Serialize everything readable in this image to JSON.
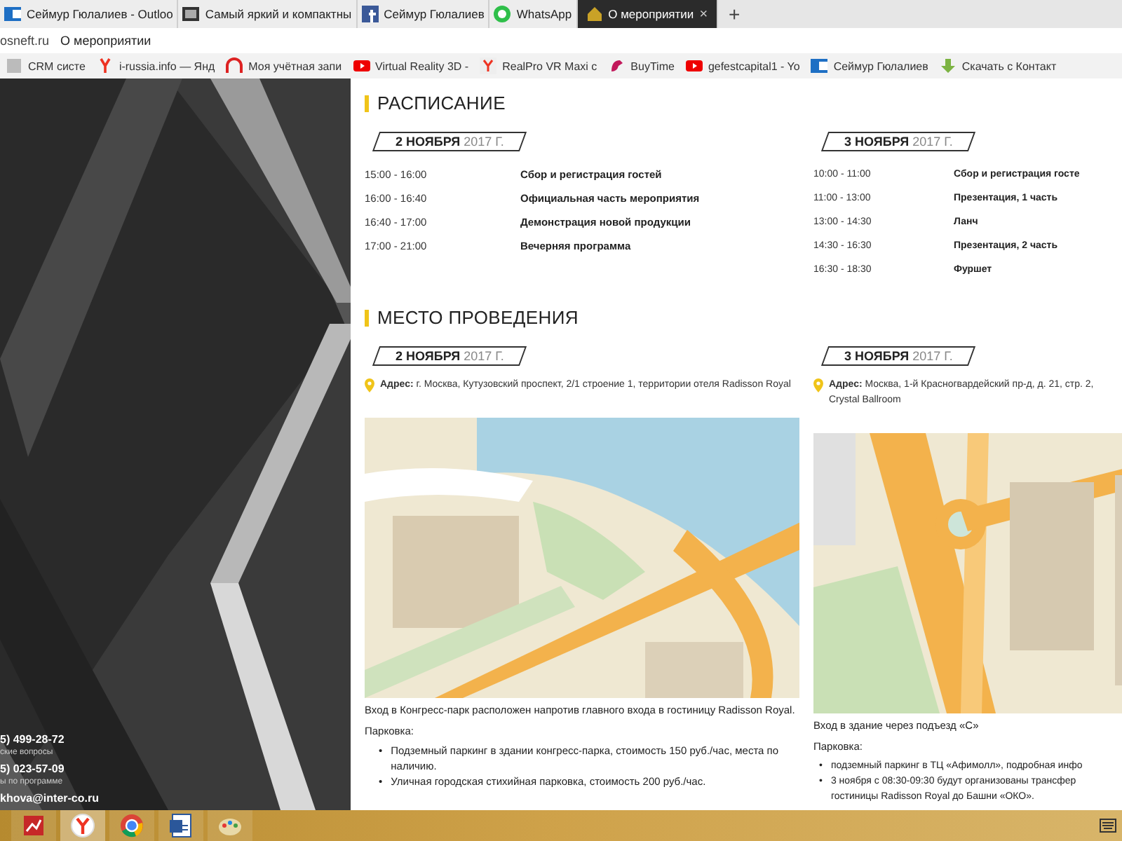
{
  "browser": {
    "tabs": [
      {
        "title": "Сеймур Гюлалиев - Outloo",
        "selected": false
      },
      {
        "title": "Самый яркий и компактны",
        "selected": false
      },
      {
        "title": "Сеймур Гюлалиев",
        "selected": false
      },
      {
        "title": "WhatsApp",
        "selected": false
      },
      {
        "title": "О мероприятии",
        "selected": true
      }
    ],
    "close": "×",
    "new_tab": "+",
    "address": {
      "host": "osneft.ru",
      "page_title": "О мероприятии"
    },
    "bookmarks": [
      "CRM систе",
      "i-russia.info — Янд",
      "Моя учётная запи",
      "Virtual Reality 3D -",
      "RealPro VR Maxi c",
      "BuyTime",
      "gefestcapital1 - Yo",
      "Сеймур Гюлалиев",
      "Скачать с Контакт"
    ]
  },
  "sidebar": {
    "contacts": [
      {
        "phone": "5) 499-28-72",
        "caption": "ские вопросы"
      },
      {
        "phone": "5) 023-57-09",
        "caption": "ы по программе"
      }
    ],
    "email": "khova@inter-co.ru"
  },
  "schedule": {
    "title": "РАСПИСАНИЕ",
    "days": [
      {
        "date": "**2 НОЯБРЯ** 2017 Г.",
        "items": [
          {
            "time": "15:00 - 16:00",
            "event": "Сбор и регистрация гостей"
          },
          {
            "time": "16:00 - 16:40",
            "event": "Официальная часть мероприятия"
          },
          {
            "time": "16:40 - 17:00",
            "event": "Демонстрация новой продукции"
          },
          {
            "time": "17:00 - 21:00",
            "event": "Вечерняя программа"
          }
        ]
      },
      {
        "date": "**3 НОЯБРЯ** 2017 Г.",
        "items": [
          {
            "time": "10:00 - 11:00",
            "event": "Сбор и регистрация госте"
          },
          {
            "time": "11:00 - 13:00",
            "event": "Презентация, 1 часть"
          },
          {
            "time": "13:00 - 14:30",
            "event": "Ланч"
          },
          {
            "time": "14:30 - 16:30",
            "event": "Презентация, 2 часть"
          },
          {
            "time": "16:30 - 18:30",
            "event": "Фуршет"
          }
        ]
      }
    ]
  },
  "venue": {
    "title": "МЕСТО ПРОВЕДЕНИЯ",
    "bullet": "•",
    "days": [
      {
        "date": "**2 НОЯБРЯ** 2017 Г.",
        "address": "**Адрес:** г. Москва, Кутузовский проспект, 2/1 строение 1, территории отеля Radisson Royal",
        "note": "Вход в Конгресс-парк расположен напротив главного входа в гостиницу Radisson Royal.",
        "parking_label": "Парковка:",
        "parking": [
          "Подземный паркинг в здании конгресс-парка, стоимость 150 руб./час, места по наличию.",
          "Уличная городская стихийная парковка, стоимость 200 руб./час."
        ]
      },
      {
        "date": "**3 НОЯБРЯ** 2017 Г.",
        "address": "**Адрес:** Москва, 1-й Красногвардейский пр-д, д. 21, стр. 2,\nCrystal Ballroom",
        "note": "Вход в здание через подъезд «С»",
        "parking_label": "Парковка:",
        "parking": [
          "подземный паркинг в ТЦ «Афимолл», подробная инфо",
          "3 ноября с 08:30-09:30 будут организованы трансфер\nгостиницы Radisson Royal до Башни «ОКО»."
        ]
      }
    ]
  }
}
